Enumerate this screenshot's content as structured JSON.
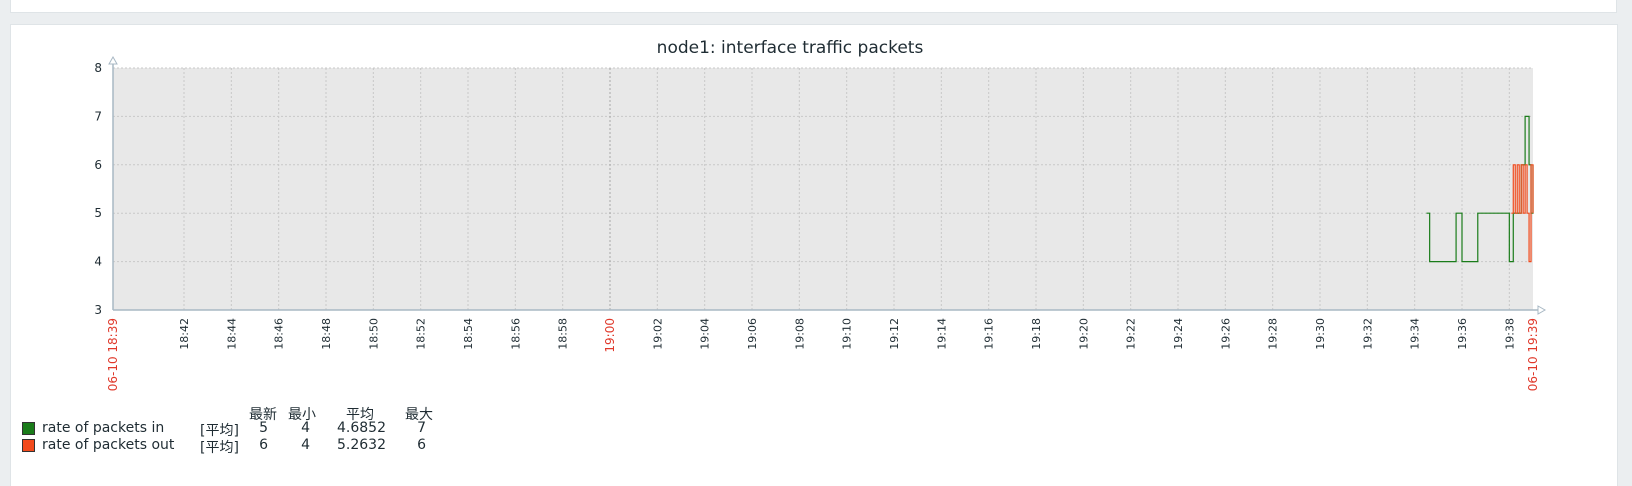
{
  "chart_data": {
    "type": "line",
    "title": "node1: interface traffic packets",
    "xlabel": "",
    "ylabel": "",
    "ylim": [
      3,
      8
    ],
    "y_ticks": [
      "3",
      "4",
      "5",
      "6",
      "7",
      "8"
    ],
    "x_range": [
      "2024-06-10 18:39",
      "2024-06-10 19:39"
    ],
    "x_start_label": "06-10 18:39",
    "x_end_label": "06-10 19:39",
    "x_ticks": [
      "18:42",
      "18:44",
      "18:46",
      "18:48",
      "18:50",
      "18:52",
      "18:54",
      "18:56",
      "18:58",
      "19:00",
      "19:02",
      "19:04",
      "19:06",
      "19:08",
      "19:10",
      "19:12",
      "19:14",
      "19:16",
      "19:18",
      "19:20",
      "19:22",
      "19:24",
      "19:26",
      "19:28",
      "19:30",
      "19:32",
      "19:34",
      "19:36",
      "19:38"
    ],
    "x_ticks_highlighted": [
      "19:00"
    ],
    "grid": true,
    "legend_position": "bottom-left",
    "colors": {
      "in": "#1a7c1a",
      "out": "#f24a1c",
      "plot_bg": "#e8e8e8",
      "grid": "#c8c8c8",
      "axis": "#a8b8c4"
    },
    "series": [
      {
        "name": "rate of packets in",
        "x": [
          "19:34:30",
          "19:34:38",
          "19:35:00",
          "19:35:40",
          "19:35:45",
          "19:36:00",
          "19:36:35",
          "19:36:40",
          "19:37:40",
          "19:38:00",
          "19:38:10",
          "19:38:20",
          "19:38:30",
          "19:38:40",
          "19:38:50",
          "19:38:55",
          "19:39:00"
        ],
        "values": [
          5,
          4,
          4,
          4,
          5,
          4,
          4,
          5,
          5,
          4,
          5,
          5,
          6,
          7,
          6,
          5,
          6
        ]
      },
      {
        "name": "rate of packets out",
        "x": [
          "19:38:05",
          "19:38:10",
          "19:38:15",
          "19:38:20",
          "19:38:25",
          "19:38:30",
          "19:38:35",
          "19:38:40",
          "19:38:45",
          "19:38:50",
          "19:38:55",
          "19:39:00"
        ],
        "values": [
          5,
          6,
          5,
          6,
          5,
          6,
          5,
          6,
          5,
          4,
          6,
          5
        ]
      }
    ],
    "legend": {
      "headers": [
        "最新",
        "最小",
        "平均",
        "最大"
      ],
      "unit": "[平均]",
      "rows": [
        {
          "name": "rate of packets in",
          "last": "5",
          "min": "4",
          "avg": "4.6852",
          "max": "7"
        },
        {
          "name": "rate of packets out",
          "last": "6",
          "min": "4",
          "avg": "5.2632",
          "max": "6"
        }
      ]
    }
  }
}
